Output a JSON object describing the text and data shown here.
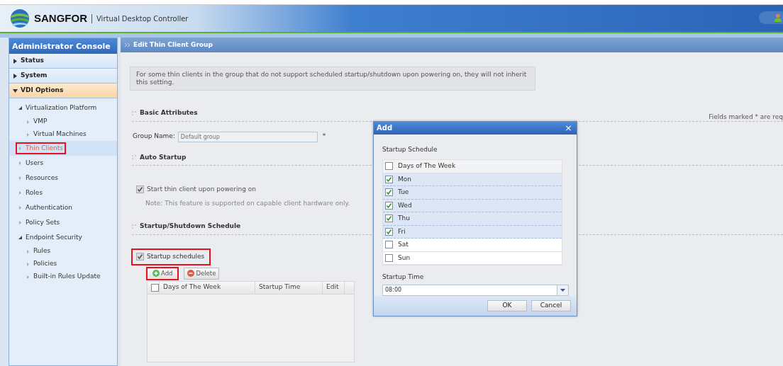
{
  "header": {
    "brand": "SANGFOR",
    "product": "Virtual Desktop Controller"
  },
  "sidebar": {
    "title": "Administrator Console",
    "sections": [
      {
        "label": "Status",
        "expanded": false,
        "selected": false
      },
      {
        "label": "System",
        "expanded": false,
        "selected": false
      },
      {
        "label": "VDI Options",
        "expanded": true,
        "selected": true,
        "items": [
          {
            "label": "Virtualization Platform",
            "expanded": true,
            "selected": false,
            "highlighted": false,
            "children": [
              {
                "label": "VMP",
                "selected": false
              },
              {
                "label": "Virtual Machines",
                "selected": false
              }
            ]
          },
          {
            "label": "Thin Clients",
            "selected": true,
            "highlighted": true
          },
          {
            "label": "Users",
            "selected": false,
            "highlighted": false
          },
          {
            "label": "Resources",
            "selected": false,
            "highlighted": false
          },
          {
            "label": "Roles",
            "selected": false,
            "highlighted": false
          },
          {
            "label": "Authentication",
            "selected": false,
            "highlighted": false
          },
          {
            "label": "Policy Sets",
            "selected": false,
            "highlighted": false
          },
          {
            "label": "Endpoint Security",
            "expanded": true,
            "selected": false,
            "highlighted": false,
            "children": [
              {
                "label": "Rules",
                "selected": false
              },
              {
                "label": "Policies",
                "selected": false
              },
              {
                "label": "Built-in Rules Update",
                "selected": false
              }
            ]
          }
        ]
      }
    ]
  },
  "page": {
    "title": "Edit Thin Client Group",
    "notice": "For some thin clients in the group that do not support scheduled startup/shutdown upon powering on, they will not inherit this setting.",
    "required_note": "Fields marked * are req",
    "basic": {
      "heading": "Basic Attributes",
      "group_name_label": "Group Name:",
      "group_name_placeholder": "Default group",
      "required_mark": "*"
    },
    "auto_startup": {
      "heading": "Auto Startup",
      "checkbox": {
        "label": "Start thin client upon powering on",
        "checked": true,
        "disabled": true
      },
      "note": "Note: This feature is supported on capable client hardware only."
    },
    "schedule": {
      "heading": "Startup/Shutdown Schedule",
      "checkbox": {
        "label": "Startup schedules",
        "checked": true,
        "highlighted": true
      },
      "buttons": [
        {
          "label": "Add",
          "kind": "add",
          "highlighted": true
        },
        {
          "label": "Delete",
          "kind": "delete",
          "highlighted": false
        }
      ],
      "table": {
        "select_all": false,
        "columns": [
          "Days of The Week",
          "Startup Time",
          "Edit"
        ]
      }
    }
  },
  "dialog": {
    "title": "Add",
    "close": "×",
    "section": "Startup Schedule",
    "column": "Days of The Week",
    "select_all": false,
    "days": [
      {
        "label": "Mon",
        "checked": true
      },
      {
        "label": "Tue",
        "checked": true
      },
      {
        "label": "Wed",
        "checked": true
      },
      {
        "label": "Thu",
        "checked": true
      },
      {
        "label": "Fri",
        "checked": true
      },
      {
        "label": "Sat",
        "checked": false
      },
      {
        "label": "Sun",
        "checked": false
      }
    ],
    "time_label": "Startup Time",
    "time_value": "08:00",
    "buttons": [
      "OK",
      "Cancel"
    ]
  }
}
